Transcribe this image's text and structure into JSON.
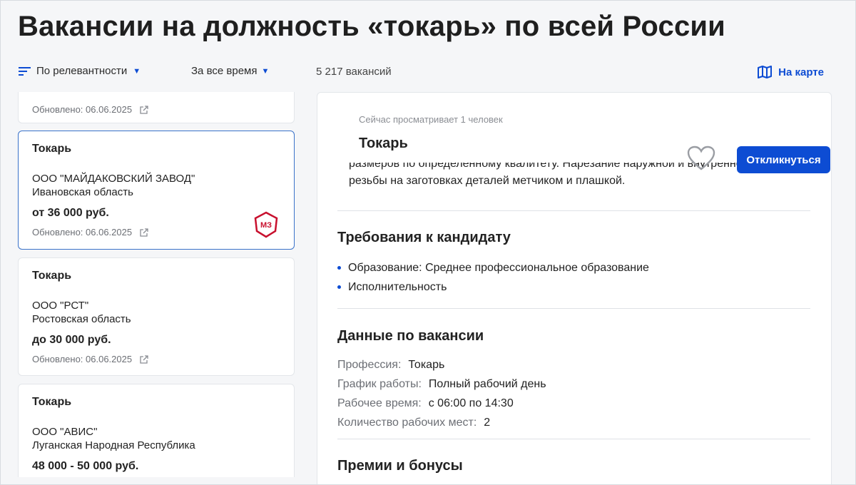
{
  "page_title": "Вакансии на должность «токарь» по всей России",
  "toolbar": {
    "sort_label": "По релевантности",
    "period_label": "За все время",
    "vacancy_count": "5 217 вакансий",
    "map_label": "На карте"
  },
  "cards": [
    {
      "updated": "Обновлено: 06.06.2025"
    },
    {
      "title": "Токарь",
      "company": "ООО \"МАЙДАКОВСКИЙ ЗАВОД\"",
      "region": "Ивановская область",
      "salary": "от 36 000 руб.",
      "updated": "Обновлено: 06.06.2025",
      "logo_text": "МЗ"
    },
    {
      "title": "Токарь",
      "company": "ООО \"РСТ\"",
      "region": "Ростовская область",
      "salary": "до 30 000 руб.",
      "updated": "Обновлено: 06.06.2025"
    },
    {
      "title": "Токарь",
      "company": "ООО \"АВИС\"",
      "region": "Луганская Народная Республика",
      "salary": "48 000 - 50 000 руб."
    }
  ],
  "detail": {
    "viewers": "Сейчас просматривает 1 человек",
    "title": "Токарь",
    "respond_label": "Откликнуться",
    "description_line1": "размеров по определенному квалитету. Нарезание наружной и внутренней",
    "description_line2": "резьбы на заготовках деталей метчиком и плашкой.",
    "requirements_title": "Требования к кандидату",
    "requirements": [
      "Образование: Среднее профессиональное образование",
      "Исполнительность"
    ],
    "data_title": "Данные по вакансии",
    "data_rows": [
      {
        "key": "Профессия:",
        "value": "Токарь"
      },
      {
        "key": "График работы:",
        "value": "Полный рабочий день"
      },
      {
        "key": "Рабочее время:",
        "value": "с 06:00 по 14:30"
      },
      {
        "key": "Количество рабочих мест:",
        "value": "2"
      }
    ],
    "bonuses_title": "Премии и бонусы"
  },
  "colors": {
    "accent": "#0d4cd3",
    "active_border": "#3a72c9",
    "logo_red": "#c8102e"
  },
  "icons": [
    "sort-icon",
    "caret-down-icon",
    "map-icon",
    "external-link-icon",
    "heart-icon",
    "company-logo"
  ]
}
